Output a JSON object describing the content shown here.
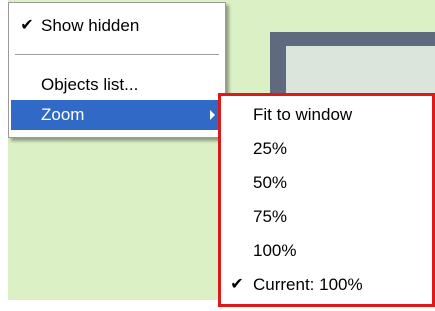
{
  "context_menu": {
    "items": [
      {
        "label": "Show hidden",
        "checked": true
      },
      {
        "label": "Objects list..."
      },
      {
        "label": "Zoom",
        "highlighted": true,
        "has_submenu": true
      }
    ]
  },
  "zoom_submenu": {
    "highlight_color": "#e01818",
    "items": [
      {
        "label": "Fit to window"
      },
      {
        "label": "25%"
      },
      {
        "label": "50%"
      },
      {
        "label": "75%"
      },
      {
        "label": "100%"
      },
      {
        "label": "Current: 100%",
        "checked": true
      }
    ]
  },
  "glyphs": {
    "check": "✔"
  },
  "colors": {
    "canvas_background": "#dcf0c6",
    "frame": "#5f6a7e",
    "selection": "#3169c6"
  }
}
